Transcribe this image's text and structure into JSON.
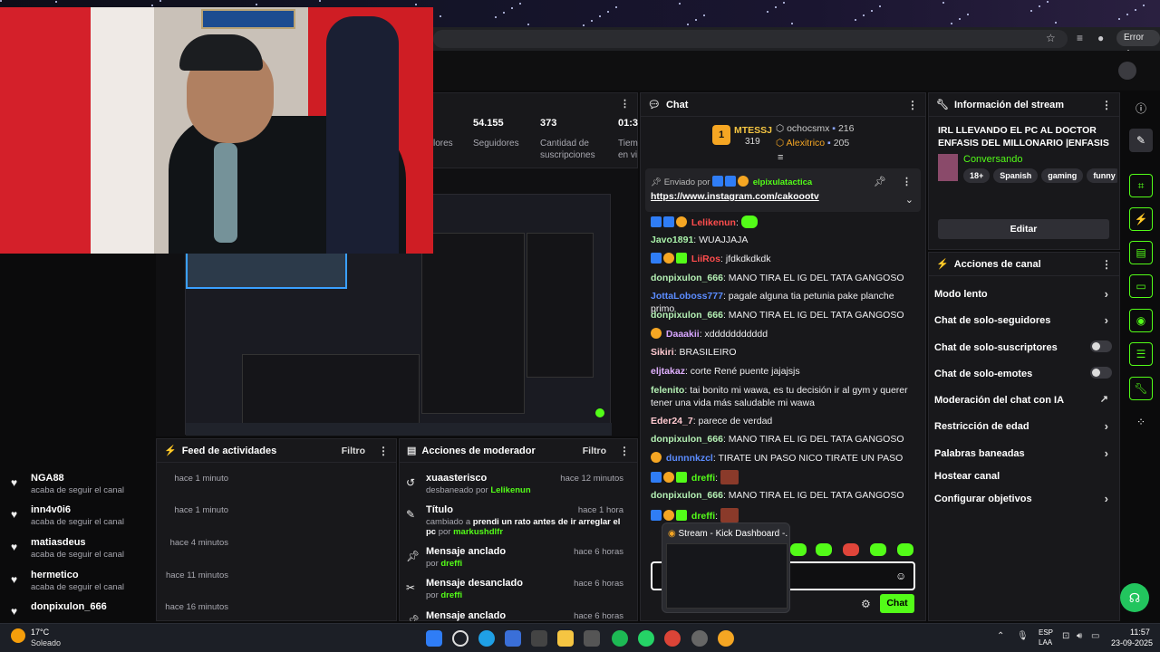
{
  "browser": {
    "error_label": "Error"
  },
  "stats": [
    {
      "value": "54.155",
      "label": "Seguidores"
    },
    {
      "value": "373",
      "label": "Cantidad de suscripciones"
    },
    {
      "value": "01:3",
      "label": "Tiem en vi"
    }
  ],
  "stats_partial": {
    "label": "lores"
  },
  "feed": {
    "title": "Feed de actividades",
    "filter": "Filtro",
    "items": [
      {
        "name": "NGA88",
        "sub": "acaba de seguir el canal",
        "time": "hace 1 minuto"
      },
      {
        "name": "inn4v0i6",
        "sub": "acaba de seguir el canal",
        "time": "hace 1 minuto"
      },
      {
        "name": "matiasdeus",
        "sub": "acaba de seguir el canal",
        "time": "hace 4 minutos"
      },
      {
        "name": "hermetico",
        "sub": "acaba de seguir el canal",
        "time": "hace 11 minutos"
      },
      {
        "name": "donpixulon_666",
        "sub": "",
        "time": "hace 16 minutos"
      }
    ]
  },
  "mod": {
    "title": "Acciones de moderador",
    "filter": "Filtro",
    "items": [
      {
        "name": "xuaasterisco",
        "sub_pre": "desbaneado por",
        "sub_user": "Lelikenun",
        "time": "hace 12 minutos"
      },
      {
        "name": "Título",
        "sub_pre": "cambiado a",
        "sub_bold": "prendi un rato antes de ir arreglar el pc",
        "sub_mid": "por",
        "sub_user": "markushdlfr",
        "time": "hace 1 hora"
      },
      {
        "name": "Mensaje anclado",
        "sub_pre": "por",
        "sub_user": "dreffi",
        "time": "hace 6 horas"
      },
      {
        "name": "Mensaje desanclado",
        "sub_pre": "por",
        "sub_user": "dreffi",
        "time": "hace 6 horas"
      },
      {
        "name": "Mensaje anclado",
        "time": "hace 6 horas"
      }
    ]
  },
  "chat": {
    "title": "Chat",
    "top": [
      {
        "rank": "1",
        "name": "MTESSJ",
        "count": "319"
      },
      {
        "name": "ochocsmx",
        "count": "216"
      },
      {
        "name": "Alexitrico",
        "count": "205"
      }
    ],
    "pinned_by_label": "Enviado por",
    "pinned_user": "elpixulatactica",
    "pinned_link": "https://www.instagram.com/cakoootv",
    "messages": [
      {
        "user": "Lelikenun",
        "color": "#ff4d4d",
        "text": ""
      },
      {
        "user": "Javo1891",
        "color": "#a8f0a8",
        "text": "WUAJJAJA"
      },
      {
        "user": "LiiRos",
        "color": "#ff4d4d",
        "text": "jfdkdkdkdk"
      },
      {
        "user": "donpixulon_666",
        "color": "#b4f0b4",
        "text": "MANO TIRA EL IG DEL TATA GANGOSO"
      },
      {
        "user": "JottaLoboss777",
        "color": "#5b8cff",
        "text": "pagale alguna tia petunia pake planche primo"
      },
      {
        "user": "donpixulon_666",
        "color": "#b4f0b4",
        "text": "MANO TIRA EL IG DEL TATA GANGOSO"
      },
      {
        "user": "Daaakii",
        "color": "#d7a5ff",
        "text": "xddddddddddd"
      },
      {
        "user": "Sikiri",
        "color": "#ffc9d0",
        "text": "BRASILEIRO"
      },
      {
        "user": "eljtakaz",
        "color": "#e0b0ff",
        "text": "corte René puente jajajsjs"
      },
      {
        "user": "felenito",
        "color": "#b4f0b4",
        "text": "tai bonito mi wawa, es tu decisión ir al gym y querer tener una vida más saludable mi wawa"
      },
      {
        "user": "Eder24_7",
        "color": "#ffc9d0",
        "text": "parece de verdad"
      },
      {
        "user": "donpixulon_666",
        "color": "#b4f0b4",
        "text": "MANO TIRA EL IG DEL TATA GANGOSO"
      },
      {
        "user": "dunnnkzcl",
        "color": "#5b8cff",
        "text": "TIRATE UN PASO NICO TIRATE UN PASO"
      },
      {
        "user": "dreffi",
        "color": "#53fc18",
        "text": ""
      },
      {
        "user": "donpixulon_666",
        "color": "#b4f0b4",
        "text": "MANO TIRA EL IG DEL TATA GANGOSO"
      },
      {
        "user": "dreffi",
        "color": "#53fc18",
        "text": ""
      }
    ],
    "send_label": "Chat",
    "preview_title": "Stream - Kick Dashboard -..."
  },
  "info": {
    "title": "Información del stream",
    "stream_title": "IRL LLEVANDO EL PC AL DOCTOR ENFASIS DEL MILLONARIO |ENFASIS DE...",
    "category": "Conversando",
    "tags": [
      "18+",
      "Spanish",
      "gaming",
      "funny"
    ],
    "edit_label": "Editar"
  },
  "actions": {
    "title": "Acciones de canal",
    "items": [
      {
        "label": "Modo lento",
        "kind": "chevron"
      },
      {
        "label": "Chat de solo-seguidores",
        "kind": "chevron"
      },
      {
        "label": "Chat de solo-suscriptores",
        "kind": "toggle"
      },
      {
        "label": "Chat de solo-emotes",
        "kind": "toggle"
      },
      {
        "label": "Moderación del chat con IA",
        "kind": "external"
      },
      {
        "label": "Restricción de edad",
        "kind": "chevron"
      },
      {
        "label": "Palabras baneadas",
        "kind": "chevron"
      },
      {
        "label": "Hostear canal",
        "kind": "none"
      },
      {
        "label": "Configurar objetivos",
        "kind": "chevron"
      }
    ]
  },
  "taskbar": {
    "temp": "17°C",
    "weather": "Soleado",
    "lang1": "ESP",
    "lang2": "LAA",
    "time": "11:57",
    "date": "23-09-2025"
  }
}
